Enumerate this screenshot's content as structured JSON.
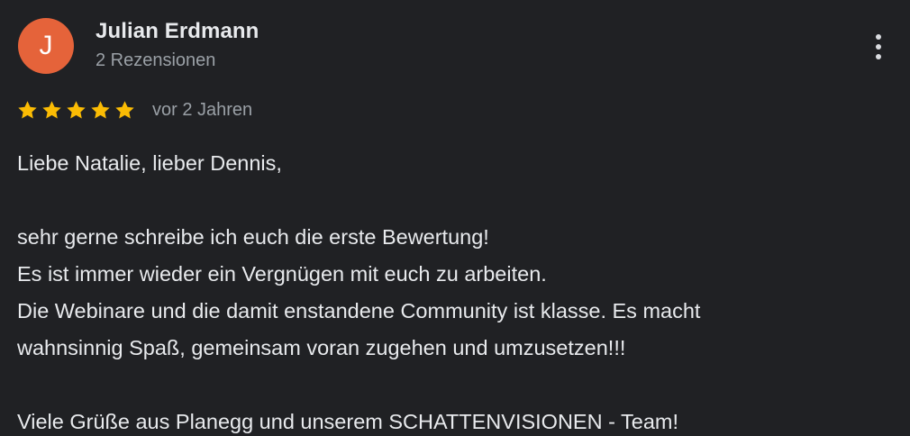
{
  "review": {
    "author": {
      "initial": "J",
      "name": "Julian Erdmann",
      "review_count_text": "2 Rezensionen",
      "avatar_color": "#e5633a"
    },
    "rating": {
      "stars": 5,
      "max_stars": 5,
      "star_color": "#fbbc04"
    },
    "date_text": "vor 2 Jahren",
    "body_lines": [
      "Liebe Natalie, lieber Dennis,",
      "",
      "sehr gerne schreibe ich euch die erste Bewertung!",
      "Es ist immer wieder ein Vergnügen mit euch zu arbeiten.",
      "Die Webinare und die damit enstandene Community ist klasse. Es macht",
      "wahnsinnig Spaß, gemeinsam voran zugehen und umzusetzen!!!",
      "",
      "Viele Grüße aus Planegg und unserem SCHATTENVISIONEN - Team!"
    ],
    "menu_icon": "more-vertical-icon"
  },
  "theme": {
    "background": "#202124",
    "text_primary": "#e8eaed",
    "text_secondary": "#9aa0a6"
  }
}
